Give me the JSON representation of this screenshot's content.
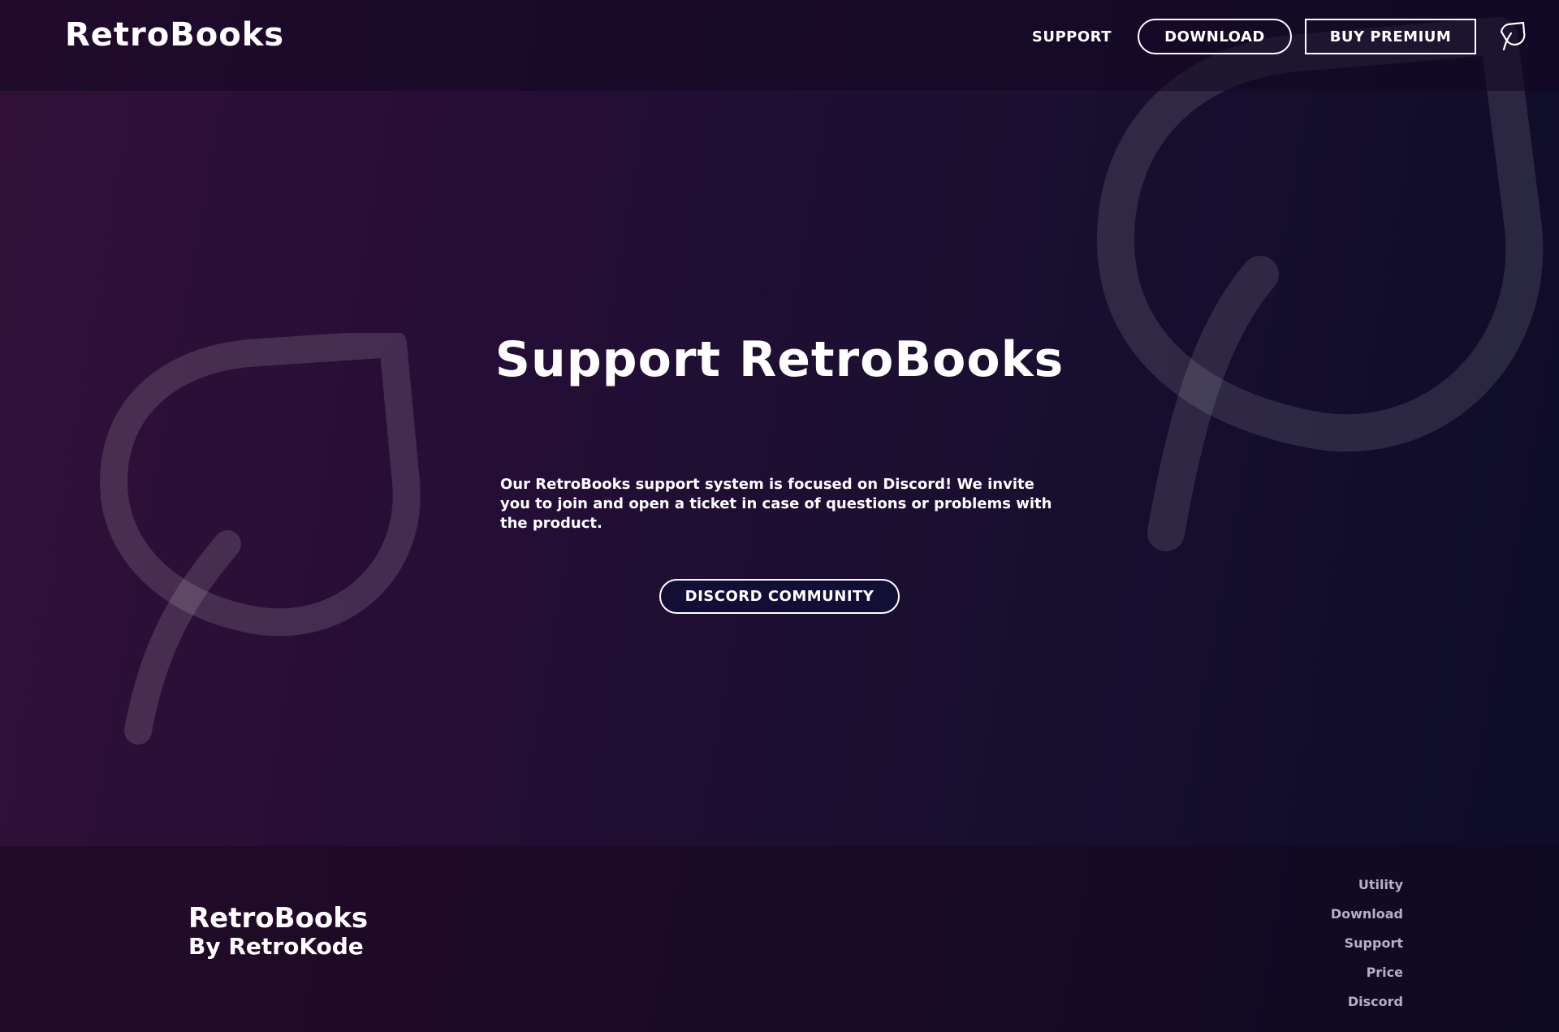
{
  "header": {
    "brand": "RetroBooks",
    "nav": {
      "support_label": "SUPPORT",
      "download_label": "DOWNLOAD",
      "premium_label": "BUY PREMIUM",
      "leaf_icon": "leaf-icon"
    }
  },
  "hero": {
    "title": "Support RetroBooks",
    "description": "Our RetroBooks support system is focused on Discord! We invite you to join and open a ticket in case of questions or problems with the product.",
    "discord_button_label": "DISCORD COMMUNITY"
  },
  "decorations": {
    "left_icon": "leaf-icon",
    "right_icon": "leaf-icon"
  },
  "footer": {
    "title": "RetroBooks",
    "subtitle": "By RetroKode",
    "links": [
      {
        "label": "Utility"
      },
      {
        "label": "Download"
      },
      {
        "label": "Support"
      },
      {
        "label": "Price"
      },
      {
        "label": "Discord"
      }
    ]
  },
  "colors": {
    "background_left": "#321038",
    "background_right": "#0d0c28",
    "text": "#ffffff",
    "footer_link": "#b7b0c2",
    "decor_stroke": "#ffffff",
    "button_fill": "#120e36"
  }
}
